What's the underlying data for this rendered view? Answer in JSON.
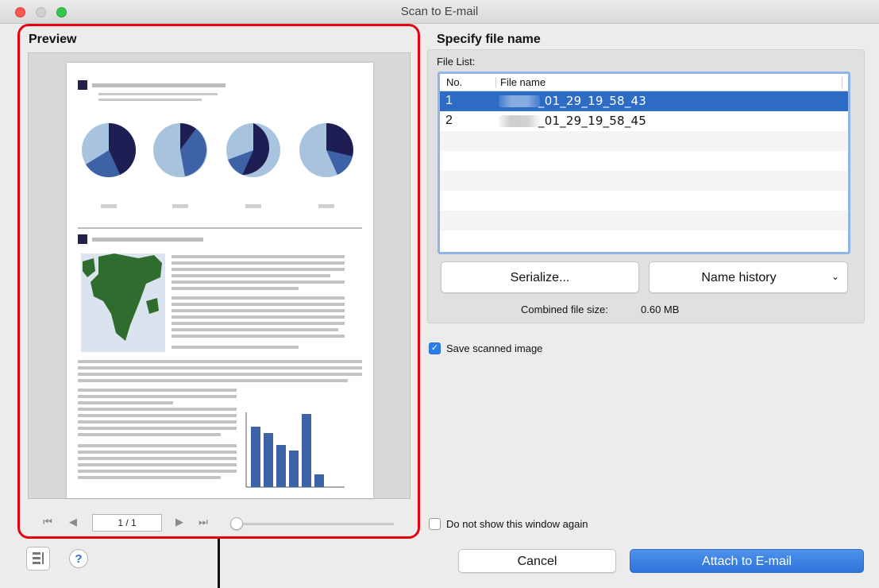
{
  "window": {
    "title": "Scan to E-mail"
  },
  "preview": {
    "title": "Preview",
    "page_indicator": "1 / 1",
    "nav": {
      "first_icon": "first-page-icon",
      "prev_icon": "previous-page-icon",
      "next_icon": "next-page-icon",
      "last_icon": "last-page-icon"
    }
  },
  "file_spec": {
    "title": "Specify file name",
    "file_list_label": "File List:",
    "columns": {
      "no": "No.",
      "name": "File name"
    },
    "rows": [
      {
        "no": "1",
        "name": "_01_29_19_58_43",
        "selected": true
      },
      {
        "no": "2",
        "name": "_01_29_19_58_45",
        "selected": false
      }
    ],
    "serialize_label": "Serialize...",
    "name_history_label": "Name history",
    "combined_size_label": "Combined file size:",
    "combined_size_value": "0.60  MB"
  },
  "options": {
    "save_scanned_image": {
      "label": "Save scanned image",
      "checked": true
    },
    "do_not_show": {
      "label": "Do not show this window again",
      "checked": false
    }
  },
  "footer": {
    "cancel_label": "Cancel",
    "attach_label": "Attach to E-mail",
    "help_glyph": "?"
  },
  "colors": {
    "accent": "#2f7ce6",
    "selection": "#2d6bc4",
    "highlight": "#e60012"
  }
}
